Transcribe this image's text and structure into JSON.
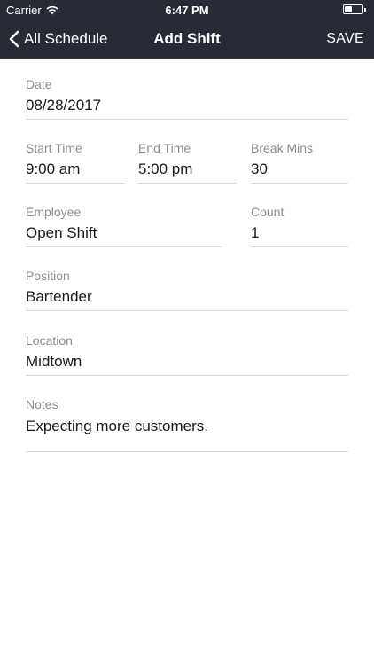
{
  "status_bar": {
    "carrier": "Carrier",
    "time": "6:47 PM",
    "icons": [
      "wifi-icon",
      "battery-icon"
    ]
  },
  "nav": {
    "back_label": "All Schedule",
    "title": "Add Shift",
    "save_label": "SAVE",
    "back_icon": "chevron-left-icon"
  },
  "colors": {
    "navbar_background": "#262b35",
    "label": "#8a8f96",
    "divider": "#d5d7da"
  },
  "form": {
    "date": {
      "label": "Date",
      "value": "08/28/2017"
    },
    "start_time": {
      "label": "Start Time",
      "value": "9:00 am"
    },
    "end_time": {
      "label": "End Time",
      "value": "5:00 pm"
    },
    "break_mins": {
      "label": "Break Mins",
      "value": "30"
    },
    "employee": {
      "label": "Employee",
      "value": "Open Shift"
    },
    "count": {
      "label": "Count",
      "value": "1"
    },
    "position": {
      "label": "Position",
      "value": "Bartender"
    },
    "location": {
      "label": "Location",
      "value": "Midtown"
    },
    "notes": {
      "label": "Notes",
      "value": "Expecting more customers."
    }
  }
}
